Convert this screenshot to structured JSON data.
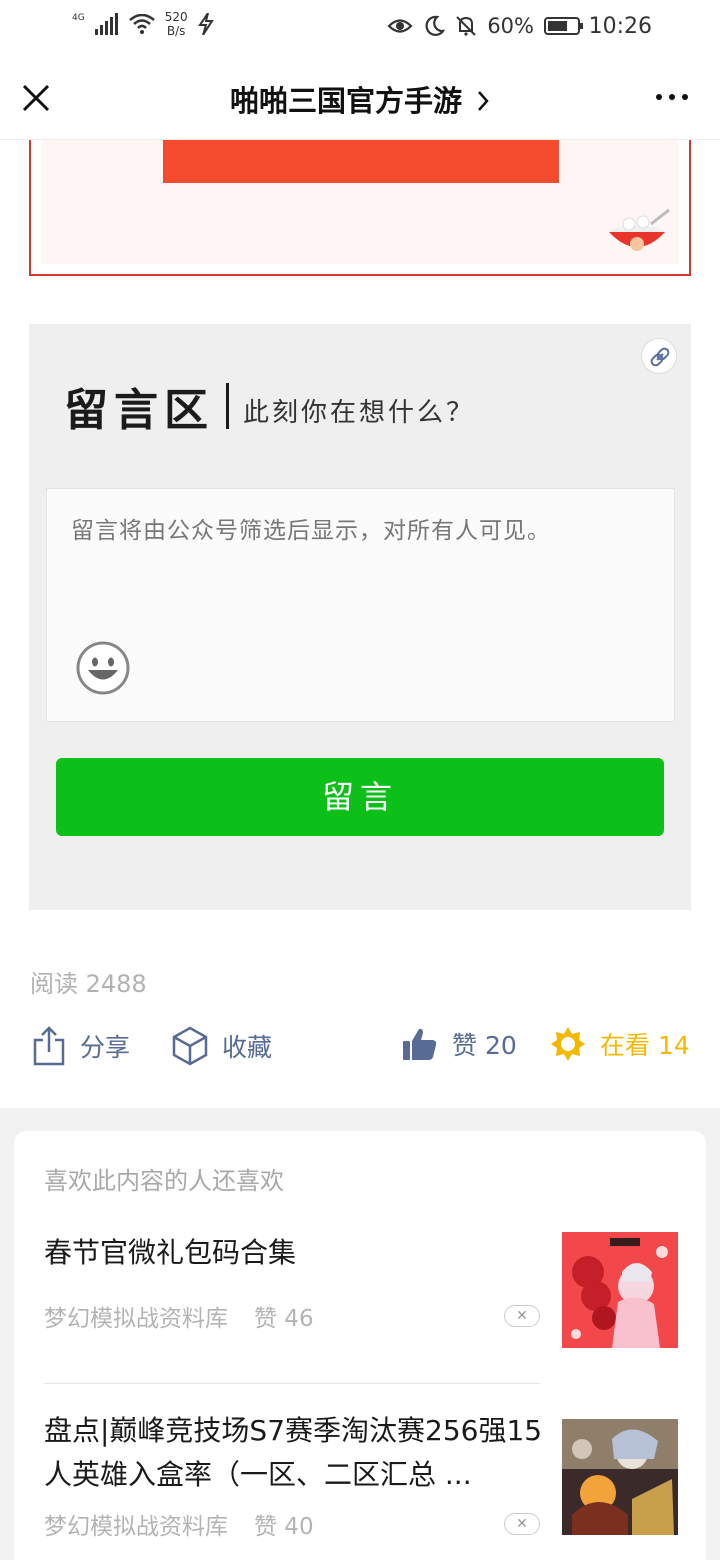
{
  "status_bar": {
    "network": "4G",
    "speed_value": "520",
    "speed_unit": "B/s",
    "battery": "60%",
    "time": "10:26"
  },
  "header": {
    "title": "啪啪三国官方手游",
    "close_icon": "close-icon",
    "more_icon": "more-icon"
  },
  "comment": {
    "title": "留言区",
    "subtitle": "此刻你在想什么？",
    "placeholder": "留言将由公众号筛选后显示，对所有人可见。",
    "submit_label": "留言"
  },
  "stats": {
    "reads": "阅读 2488"
  },
  "actions": {
    "share_label": "分享",
    "favorite_label": "收藏",
    "like_label": "赞 20",
    "wow_label": "在看 14",
    "colors": {
      "link": "#576b95",
      "wow": "#f5b800",
      "submit": "#0dbf19"
    }
  },
  "recommendations": {
    "header": "喜欢此内容的人还喜欢",
    "items": [
      {
        "title": "春节官微礼包码合集",
        "source": "梦幻模拟战资料库",
        "likes": "赞 46"
      },
      {
        "title": "盘点|巅峰竞技场S7赛季淘汰赛256强15人英雄入盒率（一区、二区汇总 ...",
        "source": "梦幻模拟战资料库",
        "likes": "赞 40"
      }
    ]
  }
}
